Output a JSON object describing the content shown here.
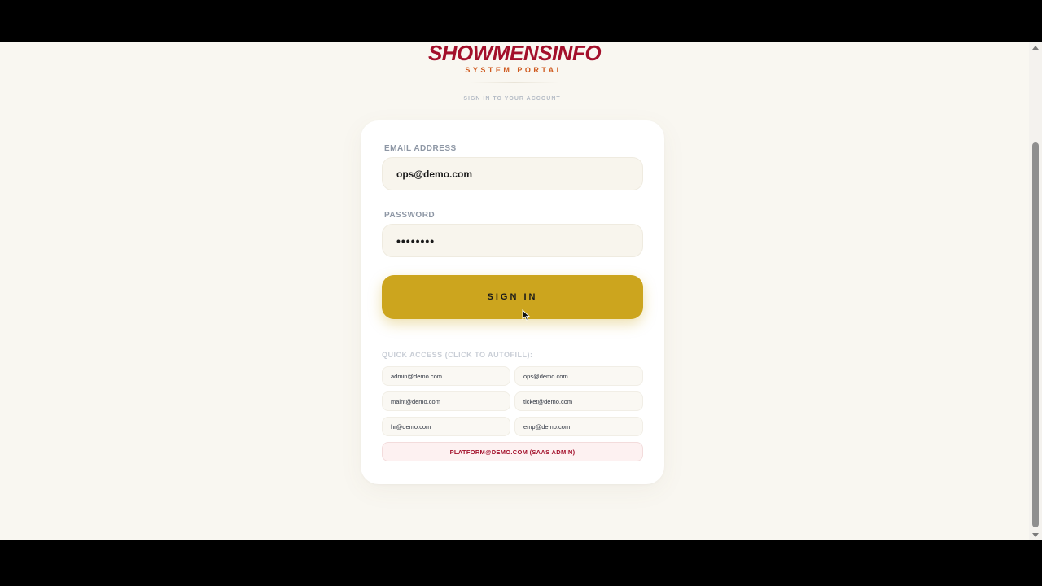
{
  "brand": {
    "name": "SHOWMENSINFO",
    "subtitle": "SYSTEM PORTAL",
    "tagline": "SIGN IN TO YOUR ACCOUNT"
  },
  "form": {
    "email_label": "EMAIL ADDRESS",
    "email_value": "ops@demo.com",
    "password_label": "PASSWORD",
    "password_value": "password",
    "submit_label": "SIGN IN"
  },
  "quick_access": {
    "label": "QUICK ACCESS (CLICK TO AUTOFILL):",
    "accounts": [
      "admin@demo.com",
      "ops@demo.com",
      "maint@demo.com",
      "ticket@demo.com",
      "hr@demo.com",
      "emp@demo.com"
    ],
    "platform_admin": "PLATFORM@DEMO.COM (SAAS ADMIN)"
  },
  "colors": {
    "brand_red": "#a3102b",
    "brand_orange": "#cf5a1f",
    "button_gold": "#cca51e",
    "page_bg": "#f9f7f1"
  }
}
